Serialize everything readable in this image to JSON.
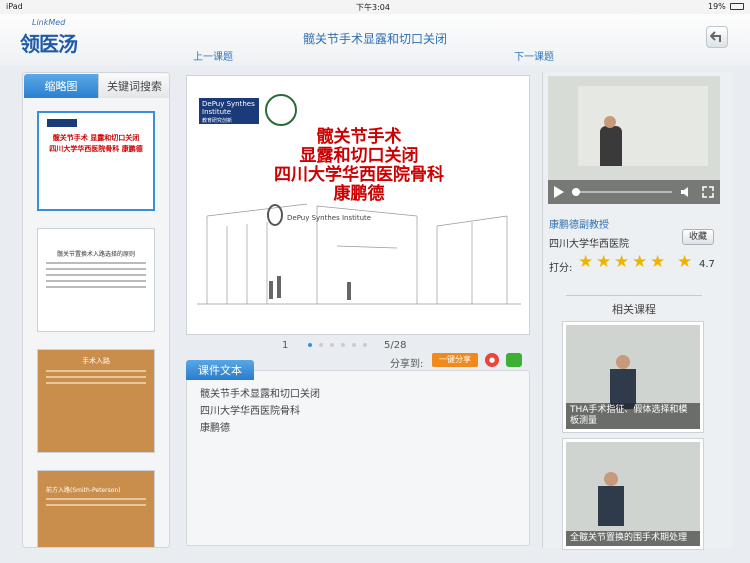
{
  "status": {
    "device": "iPad",
    "time": "下午3:04",
    "battery": "19%"
  },
  "app": {
    "logo_en": "LinkMed",
    "logo_cn": "领医汤"
  },
  "header": {
    "title": "髋关节手术显露和切口关闭",
    "prev": "上一课题",
    "next": "下一课题"
  },
  "sidebar": {
    "tabs": [
      {
        "label": "缩略图"
      },
      {
        "label": "关键词搜索"
      }
    ],
    "thumb1_title": "髋关节手术 显露和切口关闭 四川大学华西医院骨科 康鹏德",
    "thumb2_heading": "髋关节置换术入路选择的原则",
    "thumb3_heading": "手术入路",
    "thumb4_heading": "前方入路(Smith-Peterson)"
  },
  "slide": {
    "brand": "DePuy Synthes Institute",
    "brand_sub": "教育研究创新 advancing education and research",
    "lines": [
      "髋关节手术",
      "显露和切口关闭",
      "四川大学华西医院骨科",
      "康鹏德"
    ],
    "pager_left": "1",
    "pager_right": "5/28",
    "dots_total": 6,
    "dots_active": 0
  },
  "share": {
    "label": "分享到:",
    "button": "一键分享"
  },
  "text_panel": {
    "tab_label": "课件文本",
    "lines": [
      "髋关节手术显露和切口关闭",
      "四川大学华西医院骨科",
      "康鹏德"
    ]
  },
  "teacher": {
    "name": "康鹏德副教授",
    "hospital": "四川大学华西医院",
    "favorite": "收藏",
    "rating_label": "打分:",
    "rating_value": "4.7",
    "stars": 5
  },
  "related": {
    "heading": "相关课程",
    "items": [
      {
        "caption": "THA手术指征、假体选择和模板测量"
      },
      {
        "caption": "全髋关节置换的围手术期处理"
      }
    ]
  },
  "colors": {
    "accent": "#2b7fcf",
    "title_red": "#cc0000",
    "share_orange": "#f08a1c",
    "star": "#f0b400"
  }
}
